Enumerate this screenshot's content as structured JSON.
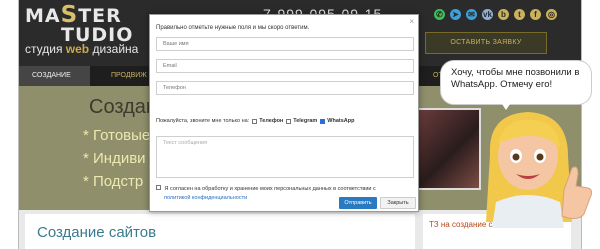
{
  "logo": {
    "line_a": "MA",
    "letter": "S",
    "line_b": "TER",
    "line_c": "TUDIO",
    "sub_a": "студия ",
    "sub_web": "web",
    "sub_b": " дизайна"
  },
  "header": {
    "phone": "7-999-095-09-15",
    "cta": "ОСТАВИТЬ ЗАЯВКУ"
  },
  "socials": [
    {
      "icon": "whatsapp-icon",
      "glyph": "✆",
      "color": "#3fbf5a"
    },
    {
      "icon": "telegram-icon",
      "glyph": "➤",
      "color": "#3f9fd8"
    },
    {
      "icon": "email-icon",
      "glyph": "✉",
      "color": "#3f9fd8"
    },
    {
      "icon": "vk-icon",
      "glyph": "vk",
      "color": "#8fb0d8"
    },
    {
      "icon": "behance-icon",
      "glyph": "b",
      "color": "#c9b25e"
    },
    {
      "icon": "twitter-icon",
      "glyph": "t",
      "color": "#c9b25e"
    },
    {
      "icon": "facebook-icon",
      "glyph": "f",
      "color": "#c9b25e"
    },
    {
      "icon": "instagram-icon",
      "glyph": "◎",
      "color": "#c9b25e"
    }
  ],
  "nav": {
    "active": "СОЗДАНИЕ",
    "item2": "ПРОДВИЖ",
    "item_right": "ОТ"
  },
  "hero": {
    "title": "Создан",
    "bullet1": "* Готовые",
    "bullet2": "* Индиви",
    "bullet3": "* Подстр"
  },
  "bottom": {
    "title": "Создание сайтов",
    "link": "ТЗ на создание сайта"
  },
  "modal": {
    "heading": "Правильно отметьте нужные поля и мы скоро ответим.",
    "name_placeholder": "Ваше имя",
    "email_placeholder": "Email",
    "phone_placeholder": "Телефон",
    "pref_label": "Пожалуйста, звоните мне только на:",
    "opt_phone": "Телефон",
    "opt_telegram": "Telegram",
    "opt_whatsapp": "WhatsApp",
    "message_placeholder": "Текст сообщения",
    "consent_text": "Я согласен на обработку и хранение моих персональных данных в соответствии с",
    "consent_link": "политикой конфиденциальности",
    "send": "Отправить",
    "cancel": "Закрыть"
  },
  "bubble": {
    "text": "Хочу, чтобы мне позвонили в WhatsApp. Отмечу его!"
  }
}
